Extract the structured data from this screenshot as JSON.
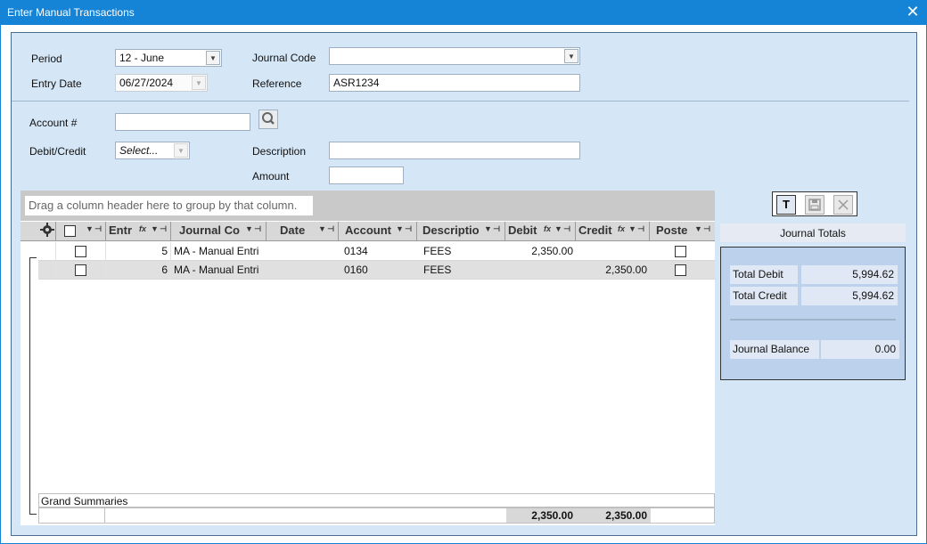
{
  "window": {
    "title": "Enter Manual Transactions",
    "close_glyph": "✕"
  },
  "form": {
    "period_label": "Period",
    "period_value": "12 - June",
    "entry_date_label": "Entry Date",
    "entry_date_value": "06/27/2024",
    "journal_code_label": "Journal Code",
    "journal_code_value": "",
    "reference_label": "Reference",
    "reference_value": "ASR1234",
    "account_label": "Account #",
    "account_value": "",
    "debit_credit_label": "Debit/Credit",
    "debit_credit_value": "Select...",
    "description_label": "Description",
    "description_value": "",
    "amount_label": "Amount",
    "amount_value": ""
  },
  "grid": {
    "group_hint": "Drag a column header here to group by that column.",
    "headers": [
      "Entr",
      "Journal Co",
      "Date",
      "Account",
      "Descriptio",
      "Debit",
      "Credit",
      "Poste"
    ],
    "rows": [
      {
        "entry": "5",
        "journal": "MA - Manual Entri",
        "date": "",
        "account": "0134",
        "description": "FEES",
        "debit": "2,350.00",
        "credit": "",
        "posted": false
      },
      {
        "entry": "6",
        "journal": "MA - Manual Entri",
        "date": "",
        "account": "0160",
        "description": "FEES",
        "debit": "",
        "credit": "2,350.00",
        "posted": false
      }
    ],
    "summary_title": "Grand Summaries",
    "summary_debit": "2,350.00",
    "summary_credit": "2,350.00"
  },
  "totals": {
    "header": "Journal Totals",
    "total_debit_label": "Total Debit",
    "total_debit_value": "5,994.62",
    "total_credit_label": "Total Credit",
    "total_credit_value": "5,994.62",
    "balance_label": "Journal Balance",
    "balance_value": "0.00",
    "toolbar": {
      "totals_glyph": "T"
    }
  },
  "colors": {
    "title_bar": "#1583d6",
    "panel_bg": "#d5e6f6",
    "totals_bg": "#bcd2ec",
    "grid_header": "#d8d8d8"
  },
  "icons": [
    "close-icon",
    "search-icon",
    "gear-icon",
    "filter-icon",
    "pin-icon",
    "formula-icon",
    "save-icon",
    "cancel-icon",
    "totals-icon"
  ]
}
